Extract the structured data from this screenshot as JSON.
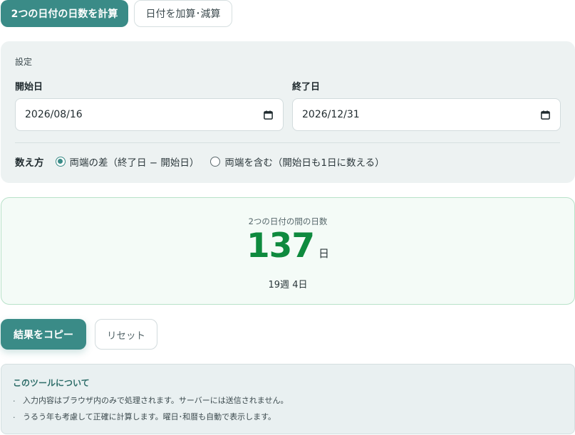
{
  "tabs": [
    {
      "label": "2つの日付の日数を計算",
      "active": true
    },
    {
      "label": "日付を加算･減算",
      "active": false
    }
  ],
  "settings": {
    "title": "設定",
    "start": {
      "label": "開始日",
      "value": "2026/08/16",
      "icon": "calendar-icon"
    },
    "end": {
      "label": "終了日",
      "value": "2026/12/31",
      "icon": "calendar-icon"
    },
    "mode": {
      "label": "数え方",
      "options": [
        {
          "label": "両端の差（終了日 − 開始日）",
          "checked": true
        },
        {
          "label": "両端を含む（開始日も1日に数える）",
          "checked": false
        }
      ]
    }
  },
  "result": {
    "caption": "2つの日付の間の日数",
    "number": "137",
    "unit": "日",
    "sub": "19週 4日"
  },
  "buttons": {
    "copy": "結果をコピー",
    "reset": "リセット"
  },
  "about": {
    "title": "このツールについて",
    "items": [
      "入力内容はブラウザ内のみで処理されます。サーバーには送信されません。",
      "うるう年も考慮して正確に計算します。曜日･和暦も自動で表示します。"
    ]
  },
  "colors": {
    "accent": "#3a8b87",
    "result_number": "#0e8a3e",
    "panel_bg": "#edf2f2",
    "result_bg": "#f4fbf7"
  }
}
